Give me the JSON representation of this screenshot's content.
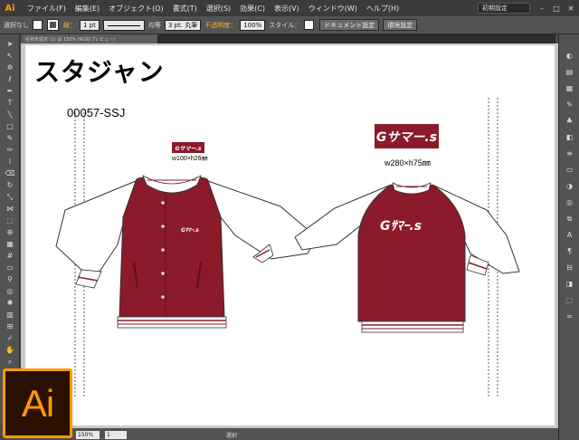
{
  "menu": {
    "app_icon_label": "Ai",
    "items": [
      "ファイル(F)",
      "編集(E)",
      "オブジェクト(O)",
      "書式(T)",
      "選択(S)",
      "効果(C)",
      "表示(V)",
      "ウィンドウ(W)",
      "ヘルプ(H)"
    ],
    "workspace": "初期設定"
  },
  "control": {
    "selection_label": "選択なし",
    "stroke_label": "線：",
    "stroke_weight": "1 pt",
    "stroke_style": "均等",
    "brush": "3 pt. 丸筆",
    "opacity_label": "不透明度：",
    "opacity_value": "100%",
    "style_label": "スタイル：",
    "doc_setup_button": "ドキュメント設定",
    "prefs_button": "環境設定"
  },
  "tab": {
    "title": "名称未設定 (1) @ 150% (RGB/プレビュー)"
  },
  "artwork": {
    "title": "スタジャン",
    "product_code": "00057-SSJ",
    "logo_text": "Gサマー.s",
    "logo_small_size": "w100×h26㎜",
    "logo_big_size": "w280×h75㎜"
  },
  "status": {
    "zoom": "150%",
    "page": "1",
    "mode": "選択"
  },
  "badge": {
    "label": "Ai"
  },
  "colors": {
    "jacket_body": "#8b1a2b",
    "sleeve": "#ffffff",
    "accent": "#ff9a00"
  }
}
